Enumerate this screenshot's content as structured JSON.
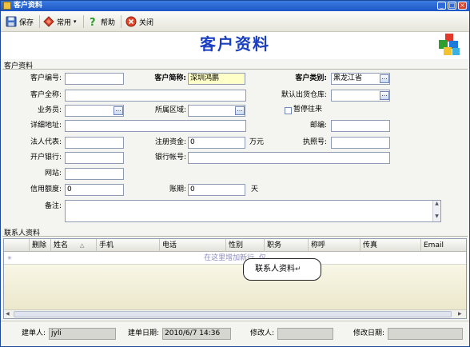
{
  "window": {
    "title": "客户资料"
  },
  "toolbar": {
    "save_label": "保存",
    "common_label": "常用",
    "help_label": "帮助",
    "close_label": "关闭"
  },
  "header": {
    "title": "客户资料"
  },
  "section_customer": "客户资料",
  "section_contacts": "联系人资料",
  "form": {
    "customer_code": {
      "label": "客户编号:",
      "value": ""
    },
    "customer_short_name": {
      "label": "客户简称:",
      "value": "深圳鸿鹏"
    },
    "customer_type": {
      "label": "客户类别:",
      "value": "黑龙江省"
    },
    "customer_full_name": {
      "label": "客户全称:",
      "value": ""
    },
    "default_warehouse": {
      "label": "默认出货仓库:",
      "value": ""
    },
    "salesperson": {
      "label": "业务员:",
      "value": ""
    },
    "region": {
      "label": "所属区域:",
      "value": ""
    },
    "suspend": {
      "label": "暂停往来"
    },
    "address": {
      "label": "详细地址:",
      "value": ""
    },
    "postcode": {
      "label": "邮编:",
      "value": ""
    },
    "legal_rep": {
      "label": "法人代表:",
      "value": ""
    },
    "reg_capital": {
      "label": "注册资金:",
      "value": "0",
      "unit": "万元"
    },
    "license_no": {
      "label": "执照号:",
      "value": ""
    },
    "bank": {
      "label": "开户银行:",
      "value": ""
    },
    "bank_account": {
      "label": "银行帐号:",
      "value": ""
    },
    "website": {
      "label": "网站:",
      "value": ""
    },
    "credit_limit": {
      "label": "信用额度:",
      "value": "0"
    },
    "account_period": {
      "label": "账期:",
      "value": "0",
      "unit": "天"
    },
    "remarks": {
      "label": "备注:",
      "value": ""
    }
  },
  "grid": {
    "columns": [
      "删除",
      "姓名",
      "手机",
      "电话",
      "性别",
      "职务",
      "称呼",
      "传真",
      "Email"
    ],
    "new_row_hint": "在这里增加新行, 仅",
    "callout": "联系人资料"
  },
  "status": {
    "creator": {
      "label": "建单人:",
      "value": "jyli"
    },
    "created_date": {
      "label": "建单日期:",
      "value": "2010/6/7 14:36"
    },
    "modifier": {
      "label": "修改人:",
      "value": ""
    },
    "modified_date": {
      "label": "修改日期:",
      "value": ""
    }
  },
  "colors": {
    "title_blue": "#1a3fc0",
    "titlebar": "#1d56c6",
    "highlight_field": "#ffffc8"
  }
}
